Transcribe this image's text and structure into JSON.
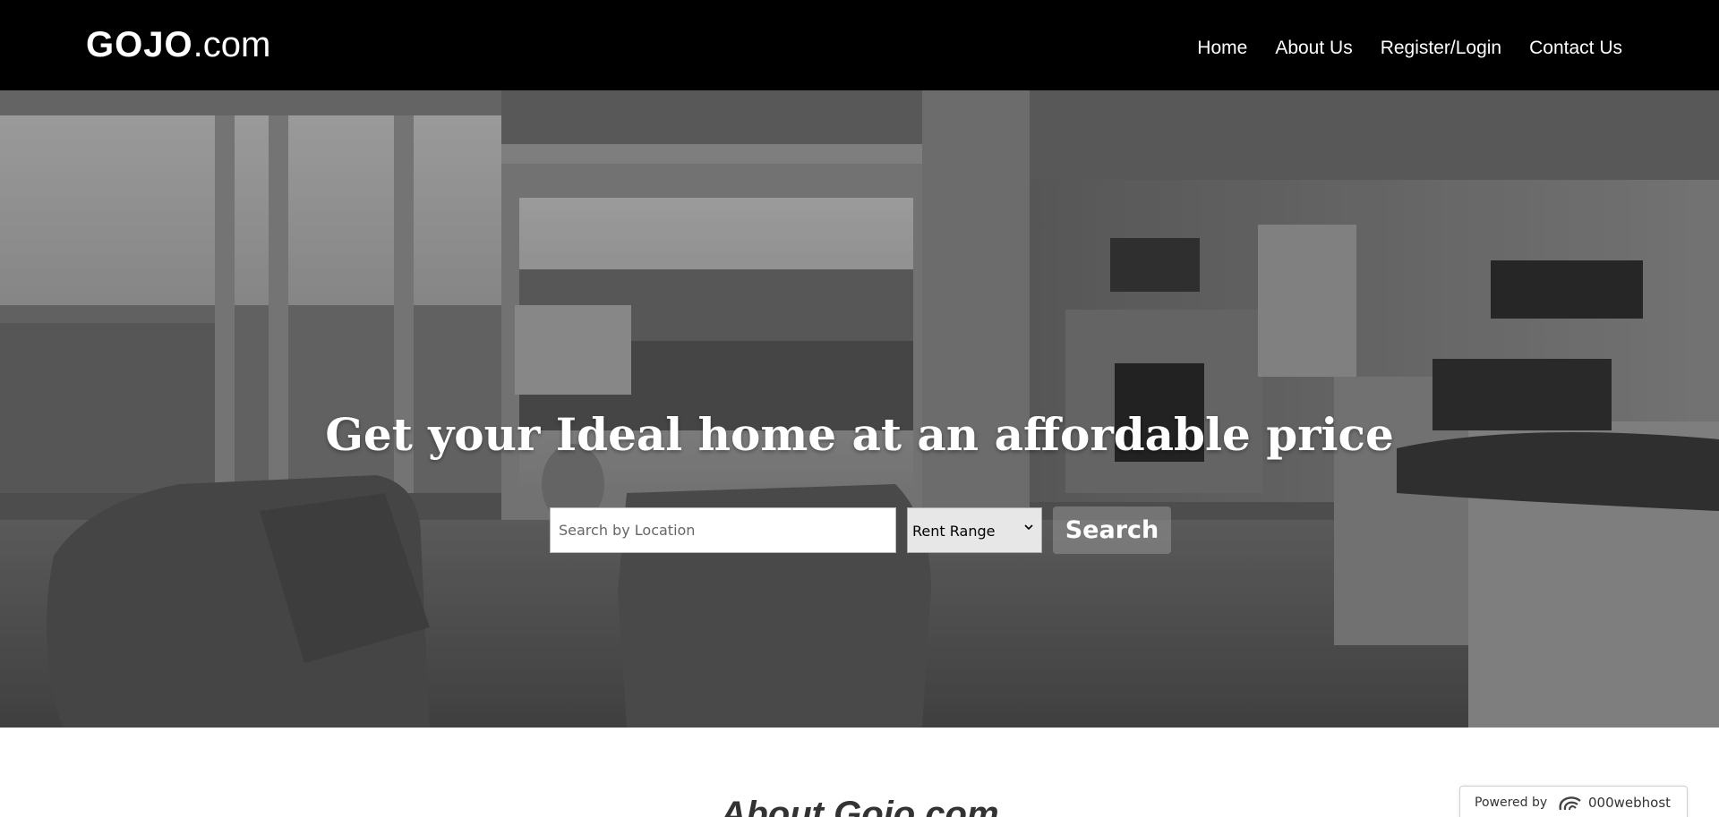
{
  "nav": {
    "brand_bold": "GOJO",
    "brand_rest": ".com",
    "links": [
      {
        "label": "Home"
      },
      {
        "label": "About Us"
      },
      {
        "label": "Register/Login"
      },
      {
        "label": "Contact Us"
      }
    ]
  },
  "hero": {
    "title": "Get your Ideal home at an affordable price",
    "search_placeholder": "Search by Location",
    "rent_range_selected": "Rent Range",
    "search_button_label": "Search"
  },
  "about": {
    "heading": "About Gojo.com"
  },
  "powered_by": {
    "label": "Powered by",
    "brand": "000webhost",
    "logo_icon": "000webhost-logo-icon"
  }
}
